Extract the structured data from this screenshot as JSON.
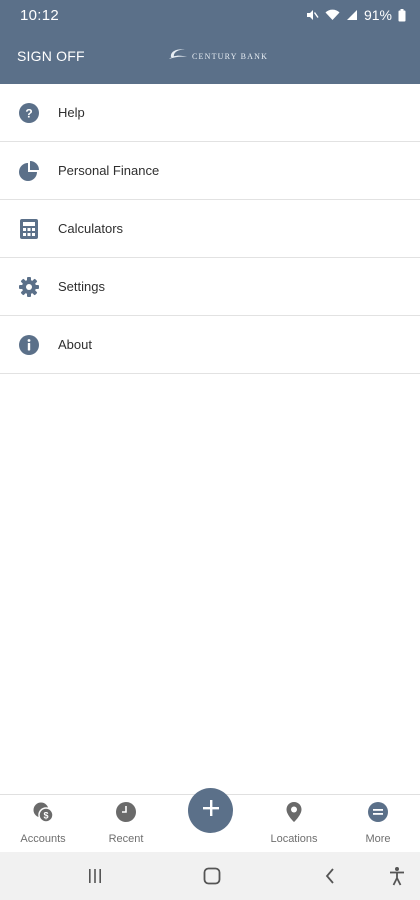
{
  "status_bar": {
    "time": "10:12",
    "battery": "91%",
    "icons": [
      "mute-icon",
      "wifi-icon",
      "signal-icon",
      "battery-icon"
    ]
  },
  "app_bar": {
    "sign_off_label": "SIGN OFF",
    "logo_text": "Century Bank"
  },
  "menu": {
    "items": [
      {
        "label": "Help",
        "icon": "help-icon"
      },
      {
        "label": "Personal Finance",
        "icon": "pie-chart-icon"
      },
      {
        "label": "Calculators",
        "icon": "calculator-icon"
      },
      {
        "label": "Settings",
        "icon": "gear-icon"
      },
      {
        "label": "About",
        "icon": "info-icon"
      }
    ]
  },
  "bottom_nav": {
    "items": [
      {
        "label": "Accounts",
        "icon": "coins-icon"
      },
      {
        "label": "Recent",
        "icon": "clock-icon"
      },
      {
        "label": "",
        "icon": "plus-icon"
      },
      {
        "label": "Locations",
        "icon": "location-pin-icon"
      },
      {
        "label": "More",
        "icon": "menu-lines-icon"
      }
    ]
  },
  "system_nav": {
    "icons": [
      "recent-apps-icon",
      "home-icon",
      "back-icon",
      "accessibility-icon"
    ]
  },
  "colors": {
    "primary": "#5b7089",
    "icon": "#5b7089",
    "divider": "#e2e2e2",
    "text": "#2f2f2f"
  }
}
